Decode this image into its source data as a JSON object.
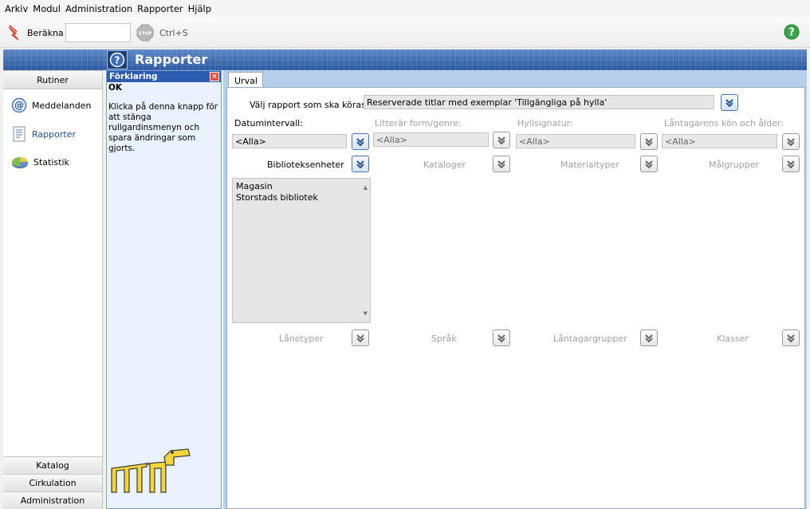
{
  "menu": [
    "Arkiv",
    "Modul",
    "Administration",
    "Rapporter",
    "Hjälp"
  ],
  "toolbar": {
    "calc_label": "Beräkna",
    "calc_value": "",
    "stop_shortcut": "Ctrl+S"
  },
  "banner": {
    "title": "Rapporter"
  },
  "nav": {
    "header": "Rutiner",
    "items": [
      {
        "label": "Meddelanden",
        "icon": "at-icon"
      },
      {
        "label": "Rapporter",
        "icon": "report-icon"
      },
      {
        "label": "Statistik",
        "icon": "pie-chart-icon"
      }
    ],
    "bottom": [
      "Katalog",
      "Cirkulation",
      "Administration"
    ]
  },
  "explain": {
    "header": "Förklaring",
    "ok": "OK",
    "text": "Klicka på denna knapp för att stänga rullgardinsmenyn och spara ändringar som gjorts."
  },
  "main": {
    "tab": "Urval",
    "report_label": "Välj rapport som ska köras:",
    "report_value": "Reserverade titlar med exemplar 'Tillgängliga på hylla'",
    "row1": [
      {
        "label": "Datumintervall:",
        "value": "<Alla>"
      },
      {
        "label": "Litterär form/genre:",
        "value": "<Alla>"
      },
      {
        "label": "Hyllsignatur:",
        "value": "<Alla>"
      },
      {
        "label": "Låntagarens kön och ålder:",
        "value": "<Alla>"
      }
    ],
    "row2": [
      "Biblioteksenheter",
      "Kataloger",
      "Materialtyper",
      "Målgrupper"
    ],
    "library_units": [
      "Magasin",
      "Storstads bibliotek"
    ],
    "row3": [
      "Lånetyper",
      "Språk",
      "Låntagargrupper",
      "Klasser"
    ]
  }
}
